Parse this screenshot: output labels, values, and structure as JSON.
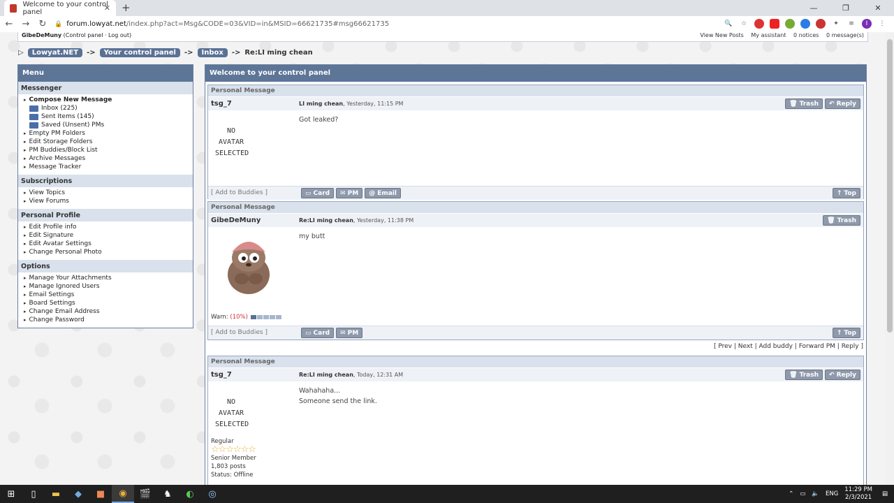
{
  "browser": {
    "tab_title": "Welcome to your control panel",
    "url_host": "forum.lowyat.net",
    "url_path": "/index.php?act=Msg&CODE=03&VID=in&MSID=66621735#msg66621735"
  },
  "userbar": {
    "username": "GibeDeMuny",
    "links_left": "(Control panel · Log out)",
    "links_right": [
      "View New Posts",
      "My assistant",
      "0 notices",
      "0 message(s)"
    ]
  },
  "breadcrumb": {
    "items": [
      "Lowyat.NET",
      "Your control panel",
      "Inbox"
    ],
    "current": "Re:LI ming chean",
    "separator": "->"
  },
  "menu": {
    "title": "Menu",
    "sections": [
      {
        "title": "Messenger",
        "items": [
          "Compose New Message",
          "Inbox (225)",
          "Sent Items (145)",
          "Saved (Unsent) PMs",
          "Empty PM Folders",
          "Edit Storage Folders",
          "PM Buddies/Block List",
          "Archive Messages",
          "Message Tracker"
        ]
      },
      {
        "title": "Subscriptions",
        "items": [
          "View Topics",
          "View Forums"
        ]
      },
      {
        "title": "Personal Profile",
        "items": [
          "Edit Profile info",
          "Edit Signature",
          "Edit Avatar Settings",
          "Change Personal Photo"
        ]
      },
      {
        "title": "Options",
        "items": [
          "Manage Your Attachments",
          "Manage Ignored Users",
          "Email Settings",
          "Board Settings",
          "Change Email Address",
          "Change Password"
        ]
      }
    ]
  },
  "main": {
    "title": "Welcome to your control panel",
    "pm_label": "Personal Message",
    "no_avatar_line1": "NO AVATAR",
    "no_avatar_line2": "SELECTED",
    "add_to_buddies": "[ Add to Buddies ]",
    "buttons": {
      "trash": "Trash",
      "reply": "Reply",
      "card": "Card",
      "pm": "PM",
      "email": "Email",
      "top": "Top"
    },
    "messages": [
      {
        "author": "tsg_7",
        "subject": "LI ming chean",
        "time": "Yesterday, 11:15 PM",
        "body": [
          "Got leaked?"
        ]
      },
      {
        "author": "GibeDeMuny",
        "subject": "Re:LI ming chean",
        "time": "Yesterday, 11:38 PM",
        "body": [
          "my butt"
        ],
        "warn_label": "Warn:",
        "warn_pct": "(10%)",
        "warn_level": 0.1
      },
      {
        "author": "tsg_7",
        "subject": "Re:LI ming chean",
        "time": "Today, 12:31 AM",
        "body": [
          "Wahahaha...",
          "Someone send the link."
        ],
        "rank": "Regular",
        "group": "Senior Member",
        "posts": "1,803 posts",
        "status": "Status: Offline",
        "stars": 6
      }
    ],
    "pm_links": "[ Prev | Next | Add buddy | Forward PM | Reply ]"
  },
  "taskbar": {
    "language": "ENG",
    "time": "11:29 PM",
    "date": "2/3/2021"
  }
}
